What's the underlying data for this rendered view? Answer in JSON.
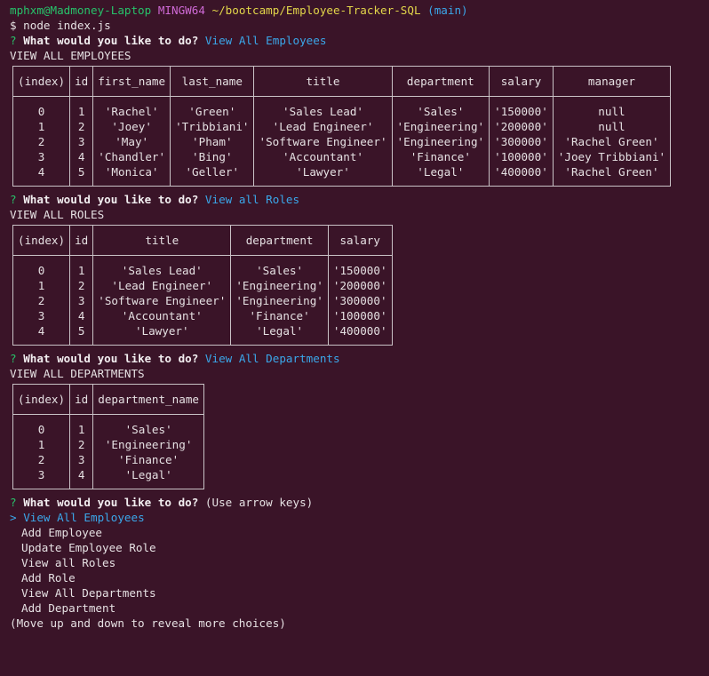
{
  "prompt": {
    "user": "mphxm@Madmoney-Laptop",
    "system": "MINGW64",
    "path": "~/bootcamp/Employee-Tracker-SQL",
    "branch": "(main)",
    "command": "$ node index.js"
  },
  "question_mark": "?",
  "question_text": "What would you like to do?",
  "employees_section": {
    "answer": "View All Employees",
    "heading": "VIEW ALL EMPLOYEES",
    "columns": [
      "(index)",
      "id",
      "first_name",
      "last_name",
      "title",
      "department",
      "salary",
      "manager"
    ],
    "rows": [
      [
        "0",
        "1",
        "'Rachel'",
        "'Green'",
        "'Sales Lead'",
        "'Sales'",
        "'150000'",
        "null"
      ],
      [
        "1",
        "2",
        "'Joey'",
        "'Tribbiani'",
        "'Lead Engineer'",
        "'Engineering'",
        "'200000'",
        "null"
      ],
      [
        "2",
        "3",
        "'May'",
        "'Pham'",
        "'Software Engineer'",
        "'Engineering'",
        "'300000'",
        "'Rachel Green'"
      ],
      [
        "3",
        "4",
        "'Chandler'",
        "'Bing'",
        "'Accountant'",
        "'Finance'",
        "'100000'",
        "'Joey Tribbiani'"
      ],
      [
        "4",
        "5",
        "'Monica'",
        "'Geller'",
        "'Lawyer'",
        "'Legal'",
        "'400000'",
        "'Rachel Green'"
      ]
    ]
  },
  "roles_section": {
    "answer": "View all Roles",
    "heading": "VIEW ALL ROLES",
    "columns": [
      "(index)",
      "id",
      "title",
      "department",
      "salary"
    ],
    "rows": [
      [
        "0",
        "1",
        "'Sales Lead'",
        "'Sales'",
        "'150000'"
      ],
      [
        "1",
        "2",
        "'Lead Engineer'",
        "'Engineering'",
        "'200000'"
      ],
      [
        "2",
        "3",
        "'Software Engineer'",
        "'Engineering'",
        "'300000'"
      ],
      [
        "3",
        "4",
        "'Accountant'",
        "'Finance'",
        "'100000'"
      ],
      [
        "4",
        "5",
        "'Lawyer'",
        "'Legal'",
        "'400000'"
      ]
    ]
  },
  "departments_section": {
    "answer": "View All Departments",
    "heading": "VIEW ALL DEPARTMENTS",
    "columns": [
      "(index)",
      "id",
      "department_name"
    ],
    "rows": [
      [
        "0",
        "1",
        "'Sales'"
      ],
      [
        "1",
        "2",
        "'Engineering'"
      ],
      [
        "2",
        "3",
        "'Finance'"
      ],
      [
        "3",
        "4",
        "'Legal'"
      ]
    ]
  },
  "menu": {
    "hint": "(Use arrow keys)",
    "pointer": ">",
    "selected": "View All Employees",
    "options": [
      "Add Employee",
      "Update Employee Role",
      "View all Roles",
      "Add Role",
      "View All Departments",
      "Add Department"
    ],
    "footer": "(Move up and down to reveal more choices)"
  },
  "colors": {
    "background": "#3a1428",
    "string": "#27c26a",
    "number": "#e2d64a",
    "answer": "#3aa7ea",
    "host": "#cf6ad6"
  }
}
